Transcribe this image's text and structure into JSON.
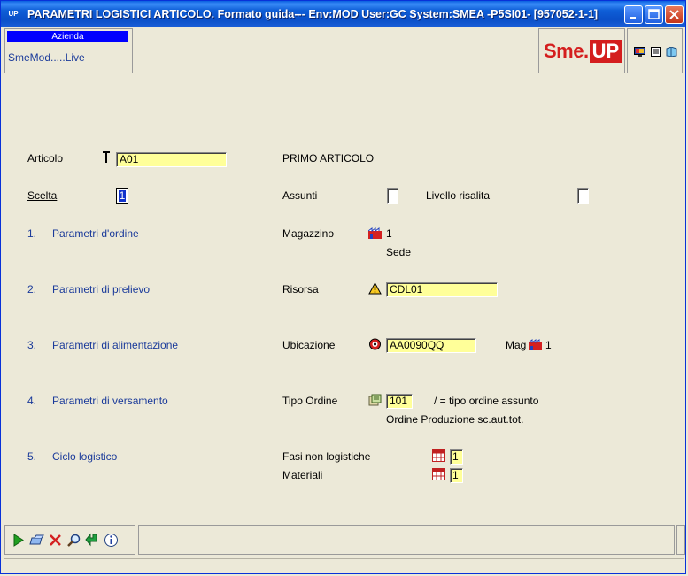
{
  "window": {
    "app_icon": "UP",
    "title": "PARAMETRI LOGISTICI ARTICOLO.  Formato guida--- Env:MOD User:GC System:SMEA -P5SI01- [957052-1-1]"
  },
  "header": {
    "azienda_title": "Azienda",
    "azienda_value": "SmeMod.....Live",
    "logo_sme": "Sme.",
    "logo_up": "UP"
  },
  "form": {
    "articolo_label": "Articolo",
    "articolo_value": "A01",
    "articolo_desc": "PRIMO ARTICOLO",
    "scelta_label": "Scelta",
    "scelta_value": "1",
    "assunti_label": "Assunti",
    "livello_label": "Livello risalita"
  },
  "menu": [
    {
      "num": "1.",
      "label": "Parametri d'ordine"
    },
    {
      "num": "2.",
      "label": "Parametri di prelievo"
    },
    {
      "num": "3.",
      "label": "Parametri di alimentazione"
    },
    {
      "num": "4.",
      "label": "Parametri di versamento"
    },
    {
      "num": "5.",
      "label": "Ciclo logistico"
    }
  ],
  "details": {
    "magazzino_label": "Magazzino",
    "magazzino_value": "1",
    "magazzino_desc": "Sede",
    "risorsa_label": "Risorsa",
    "risorsa_value": "CDL01",
    "ubicazione_label": "Ubicazione",
    "ubicazione_value": "AA0090QQ",
    "mag_label": "Mag",
    "mag_value": "1",
    "tipo_ordine_label": "Tipo Ordine",
    "tipo_ordine_value": "101",
    "tipo_ordine_note": "/ = tipo ordine assunto",
    "tipo_ordine_desc": "Ordine Produzione sc.aut.tot.",
    "fasi_label": "Fasi non logistiche",
    "fasi_value": "1",
    "materiali_label": "Materiali",
    "materiali_value": "1"
  },
  "colors": {
    "field_bg": "#ffff99",
    "nav_text": "#1a3a9a",
    "brand_red": "#d41e1e",
    "titlebar_blue": "#0a4fc8"
  },
  "icons": {
    "toolbar": [
      "execute-icon",
      "clear-icon",
      "cancel-icon",
      "search-icon",
      "back-icon",
      "info-icon"
    ],
    "top_right": [
      "monitor-icon",
      "notes-icon",
      "book-icon"
    ]
  }
}
